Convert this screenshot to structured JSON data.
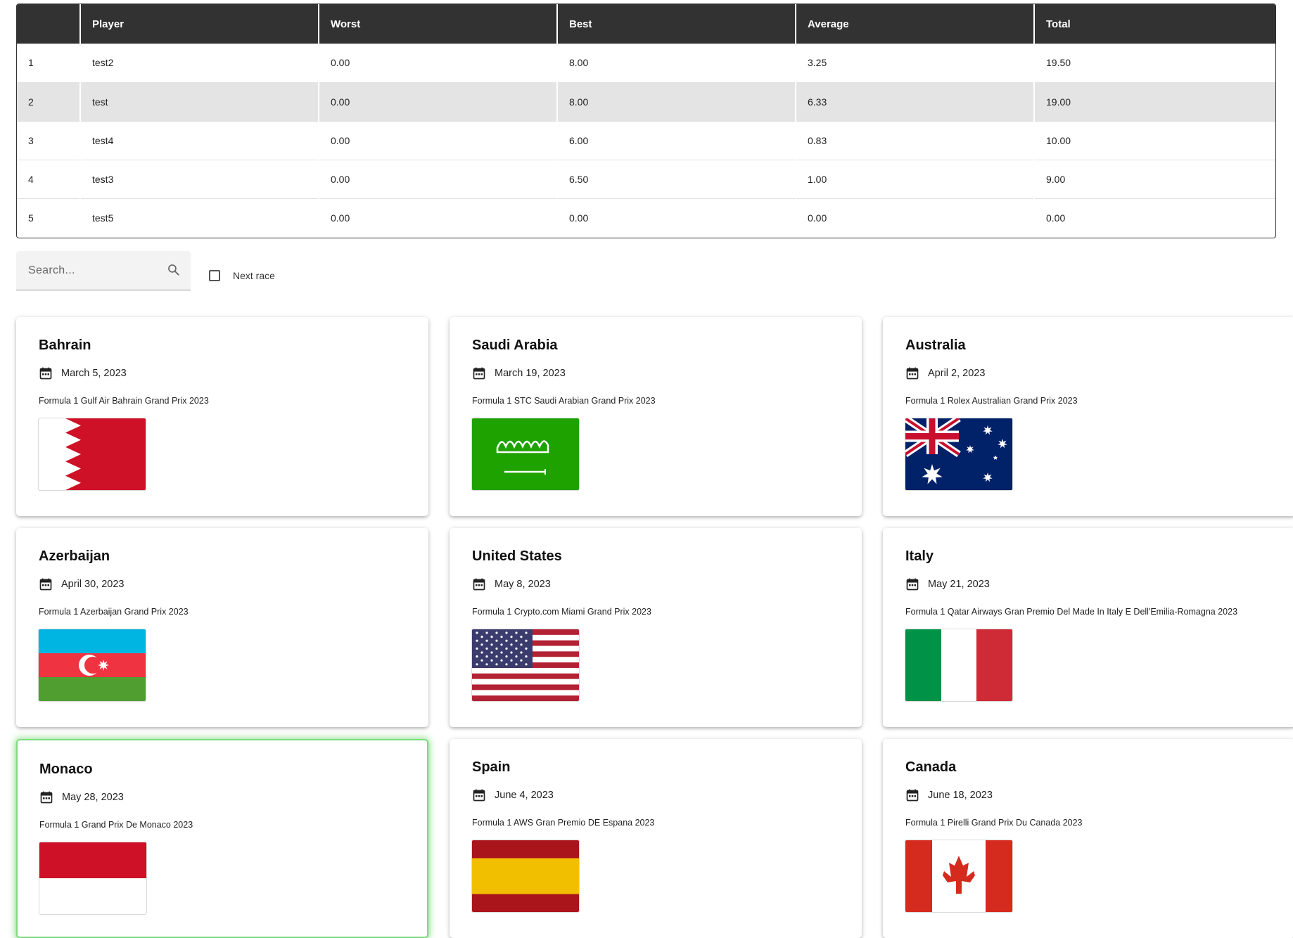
{
  "standings": {
    "columns": [
      "",
      "Player",
      "Worst",
      "Best",
      "Average",
      "Total"
    ],
    "rows": [
      {
        "rank": "1",
        "player": "test2",
        "worst": "0.00",
        "best": "8.00",
        "average": "3.25",
        "total": "19.50"
      },
      {
        "rank": "2",
        "player": "test",
        "worst": "0.00",
        "best": "8.00",
        "average": "6.33",
        "total": "19.00"
      },
      {
        "rank": "3",
        "player": "test4",
        "worst": "0.00",
        "best": "6.00",
        "average": "0.83",
        "total": "10.00"
      },
      {
        "rank": "4",
        "player": "test3",
        "worst": "0.00",
        "best": "6.50",
        "average": "1.00",
        "total": "9.00"
      },
      {
        "rank": "5",
        "player": "test5",
        "worst": "0.00",
        "best": "0.00",
        "average": "0.00",
        "total": "0.00"
      }
    ]
  },
  "filters": {
    "search_placeholder": "Search...",
    "search_value": "",
    "next_race_label": "Next race",
    "next_race_checked": false
  },
  "races": [
    {
      "country": "Bahrain",
      "date": "March 5, 2023",
      "name": "Formula 1 Gulf Air Bahrain Grand Prix 2023",
      "flag": "bahrain-flag",
      "highlight": false
    },
    {
      "country": "Saudi Arabia",
      "date": "March 19, 2023",
      "name": "Formula 1 STC Saudi Arabian Grand Prix 2023",
      "flag": "saudi-arabia-flag",
      "highlight": false
    },
    {
      "country": "Australia",
      "date": "April 2, 2023",
      "name": "Formula 1 Rolex Australian Grand Prix 2023",
      "flag": "australia-flag",
      "highlight": false
    },
    {
      "country": "Azerbaijan",
      "date": "April 30, 2023",
      "name": "Formula 1 Azerbaijan Grand Prix 2023",
      "flag": "azerbaijan-flag",
      "highlight": false
    },
    {
      "country": "United States",
      "date": "May 8, 2023",
      "name": "Formula 1 Crypto.com Miami Grand Prix 2023",
      "flag": "united-states-flag",
      "highlight": false
    },
    {
      "country": "Italy",
      "date": "May 21, 2023",
      "name": "Formula 1 Qatar Airways Gran Premio Del Made In Italy E Dell'Emilia-Romagna 2023",
      "flag": "italy-flag",
      "highlight": false
    },
    {
      "country": "Monaco",
      "date": "May 28, 2023",
      "name": "Formula 1 Grand Prix De Monaco 2023",
      "flag": "monaco-flag",
      "highlight": true
    },
    {
      "country": "Spain",
      "date": "June 4, 2023",
      "name": "Formula 1 AWS Gran Premio DE Espana 2023",
      "flag": "spain-flag",
      "highlight": false
    },
    {
      "country": "Canada",
      "date": "June 18, 2023",
      "name": "Formula 1 Pirelli Grand Prix Du Canada 2023",
      "flag": "canada-flag",
      "highlight": false
    }
  ],
  "colors": {
    "table_header_bg": "#323232",
    "row_shade": "#e4e4e4",
    "next_race_glow": "#7fdc7f"
  }
}
